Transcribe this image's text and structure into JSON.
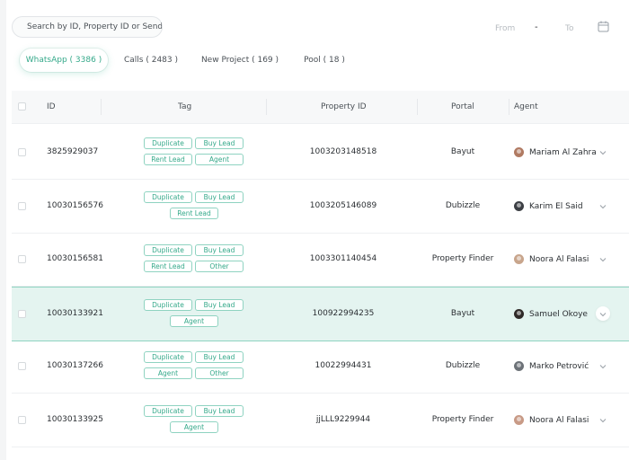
{
  "search": {
    "placeholder": "Search by ID, Property ID or Sender"
  },
  "date_filter": {
    "from_label": "From",
    "separator": "-",
    "to_label": "To"
  },
  "tabs": [
    {
      "label": "WhatsApp ( 3386 )",
      "active": true
    },
    {
      "label": "Calls ( 2483 )",
      "active": false
    },
    {
      "label": "New Project ( 169 )",
      "active": false
    },
    {
      "label": "Pool ( 18 )",
      "active": false
    }
  ],
  "columns": {
    "id": "ID",
    "tag": "Tag",
    "property_id": "Property ID",
    "portal": "Portal",
    "agent": "Agent"
  },
  "colors": {
    "accent": "#35a98a",
    "tag_border": "#8fd3c1",
    "highlight_row": "#e4f4f0"
  },
  "rows": [
    {
      "id": "3825929037",
      "tags": [
        "Duplicate",
        "Buy Lead",
        "Rent Lead",
        "Agent"
      ],
      "property_id": "1003203148518",
      "portal": "Bayut",
      "agent": "Mariam Al Zahra",
      "avatar_color": "#b07a62",
      "highlighted": false
    },
    {
      "id": "10030156576",
      "tags": [
        "Duplicate",
        "Buy Lead",
        "Rent Lead"
      ],
      "property_id": "1003205146089",
      "portal": "Dubizzle",
      "agent": "Karim El Said",
      "avatar_color": "#3c3f44",
      "highlighted": false
    },
    {
      "id": "10030156581",
      "tags": [
        "Duplicate",
        "Buy Lead",
        "Rent Lead",
        "Other"
      ],
      "property_id": "1003301140454",
      "portal": "Property Finder",
      "agent": "Noora Al Falasi",
      "avatar_color": "#c8a58c",
      "highlighted": false
    },
    {
      "id": "10030133921",
      "tags": [
        "Duplicate",
        "Buy Lead",
        "Agent"
      ],
      "property_id": "100922994235",
      "portal": "Bayut",
      "agent": "Samuel Okoye",
      "avatar_color": "#2f2a28",
      "highlighted": true
    },
    {
      "id": "10030137266",
      "tags": [
        "Duplicate",
        "Buy Lead",
        "Agent",
        "Other"
      ],
      "property_id": "10022994431",
      "portal": "Dubizzle",
      "agent": "Marko Petrović",
      "avatar_color": "#6d7278",
      "highlighted": false
    },
    {
      "id": "10030133925",
      "tags": [
        "Duplicate",
        "Buy Lead",
        "Agent"
      ],
      "property_id": "jjLLL9229944",
      "portal": "Property Finder",
      "agent": "Noora Al Falasi",
      "avatar_color": "#c89a86",
      "highlighted": false
    }
  ]
}
